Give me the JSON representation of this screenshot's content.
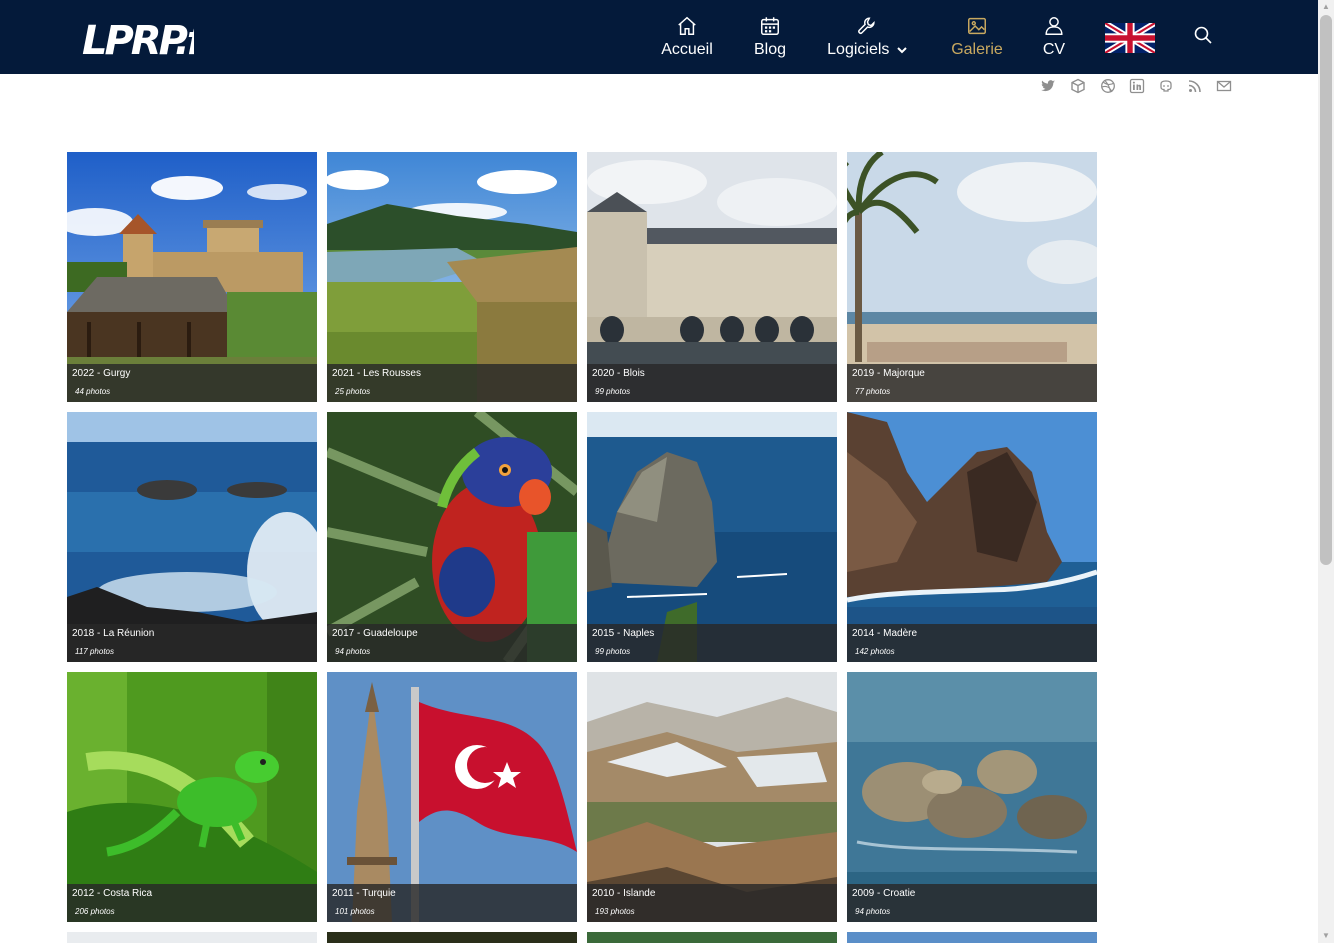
{
  "header": {
    "logo_text": "LPRP.fr",
    "nav": [
      {
        "label": "Accueil",
        "icon": "home-icon"
      },
      {
        "label": "Blog",
        "icon": "calendar-icon"
      },
      {
        "label": "Logiciels",
        "icon": "wrench-icon"
      },
      {
        "label": "Galerie",
        "icon": "image-icon",
        "active": true
      },
      {
        "label": "CV",
        "icon": "user-icon"
      }
    ],
    "language_icon": "uk-flag-icon",
    "search_icon": "search-icon"
  },
  "social_icons": [
    "twitter-icon",
    "cube-icon",
    "dribbble-icon",
    "linkedin-icon",
    "github-icon",
    "rss-icon",
    "mail-icon"
  ],
  "colors": {
    "nav_bg": "#041a3a",
    "nav_active": "#c9a960",
    "caption_bg": "#282828"
  },
  "albums": [
    {
      "title": "2022 - Gurgy",
      "count": "44 photos"
    },
    {
      "title": "2021 - Les Rousses",
      "count": "25 photos"
    },
    {
      "title": "2020 - Blois",
      "count": "99 photos"
    },
    {
      "title": "2019 - Majorque",
      "count": "77 photos"
    },
    {
      "title": "2018 - La Réunion",
      "count": "117 photos"
    },
    {
      "title": "2017 - Guadeloupe",
      "count": "94 photos"
    },
    {
      "title": "2015 - Naples",
      "count": "99 photos"
    },
    {
      "title": "2014 - Madère",
      "count": "142 photos"
    },
    {
      "title": "2012 - Costa Rica",
      "count": "206 photos"
    },
    {
      "title": "2011 - Turquie",
      "count": "101 photos"
    },
    {
      "title": "2010 - Islande",
      "count": "193 photos"
    },
    {
      "title": "2009 - Croatie",
      "count": "94 photos"
    }
  ]
}
